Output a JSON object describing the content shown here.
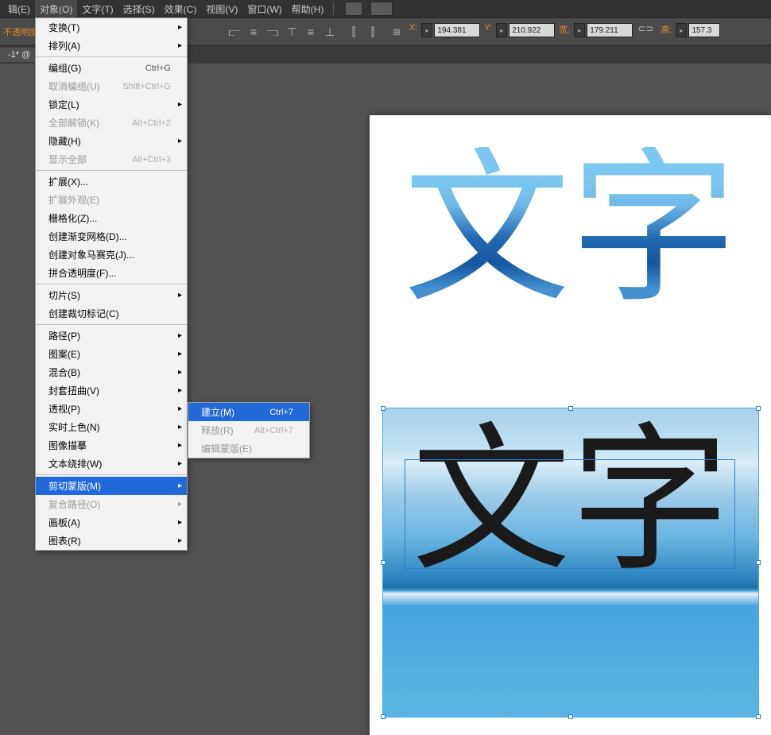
{
  "menubar": {
    "items": [
      {
        "label": "辑(E)"
      },
      {
        "label": "对象(O)"
      },
      {
        "label": "文字(T)"
      },
      {
        "label": "选择(S)"
      },
      {
        "label": "效果(C)"
      },
      {
        "label": "视图(V)"
      },
      {
        "label": "窗口(W)"
      },
      {
        "label": "帮助(H)"
      }
    ]
  },
  "optbar": {
    "left_label": "不透明度",
    "x_label": "X:",
    "x_value": "194.381",
    "y_label": "Y:",
    "y_value": "210.922",
    "w_label": "宽:",
    "w_value": "179.211",
    "h_label": "高:",
    "h_value": "157.3"
  },
  "tab": {
    "name": "-1* @"
  },
  "dropdown": [
    {
      "type": "item",
      "label": "变换(T)",
      "arrow": true
    },
    {
      "type": "item",
      "label": "排列(A)",
      "arrow": true
    },
    {
      "type": "sep"
    },
    {
      "type": "item",
      "label": "编组(G)",
      "shortcut": "Ctrl+G"
    },
    {
      "type": "item",
      "label": "取消编组(U)",
      "shortcut": "Shift+Ctrl+G",
      "disabled": true
    },
    {
      "type": "item",
      "label": "锁定(L)",
      "arrow": true
    },
    {
      "type": "item",
      "label": "全部解锁(K)",
      "shortcut": "Alt+Ctrl+2",
      "disabled": true
    },
    {
      "type": "item",
      "label": "隐藏(H)",
      "arrow": true
    },
    {
      "type": "item",
      "label": "显示全部",
      "shortcut": "Alt+Ctrl+3",
      "disabled": true
    },
    {
      "type": "sep"
    },
    {
      "type": "item",
      "label": "扩展(X)..."
    },
    {
      "type": "item",
      "label": "扩展外观(E)",
      "disabled": true
    },
    {
      "type": "item",
      "label": "栅格化(Z)..."
    },
    {
      "type": "item",
      "label": "创建渐变网格(D)..."
    },
    {
      "type": "item",
      "label": "创建对象马赛克(J)..."
    },
    {
      "type": "item",
      "label": "拼合透明度(F)..."
    },
    {
      "type": "sep"
    },
    {
      "type": "item",
      "label": "切片(S)",
      "arrow": true
    },
    {
      "type": "item",
      "label": "创建裁切标记(C)"
    },
    {
      "type": "sep"
    },
    {
      "type": "item",
      "label": "路径(P)",
      "arrow": true
    },
    {
      "type": "item",
      "label": "图案(E)",
      "arrow": true
    },
    {
      "type": "item",
      "label": "混合(B)",
      "arrow": true
    },
    {
      "type": "item",
      "label": "封套扭曲(V)",
      "arrow": true
    },
    {
      "type": "item",
      "label": "透视(P)",
      "arrow": true
    },
    {
      "type": "item",
      "label": "实时上色(N)",
      "arrow": true
    },
    {
      "type": "item",
      "label": "图像描摹",
      "arrow": true
    },
    {
      "type": "item",
      "label": "文本绕排(W)",
      "arrow": true
    },
    {
      "type": "sep"
    },
    {
      "type": "item",
      "label": "剪切蒙版(M)",
      "arrow": true,
      "highlight": true
    },
    {
      "type": "item",
      "label": "复合路径(O)",
      "arrow": true,
      "disabled": true
    },
    {
      "type": "item",
      "label": "画板(A)",
      "arrow": true
    },
    {
      "type": "item",
      "label": "图表(R)",
      "arrow": true
    }
  ],
  "submenu": [
    {
      "label": "建立(M)",
      "shortcut": "Ctrl+7",
      "highlight": true
    },
    {
      "label": "释放(R)",
      "shortcut": "Alt+Ctrl+7",
      "disabled": true
    },
    {
      "label": "编辑蒙版(E)",
      "disabled": true
    }
  ],
  "canvas": {
    "text_top": "文字",
    "text_bottom": "文字"
  }
}
